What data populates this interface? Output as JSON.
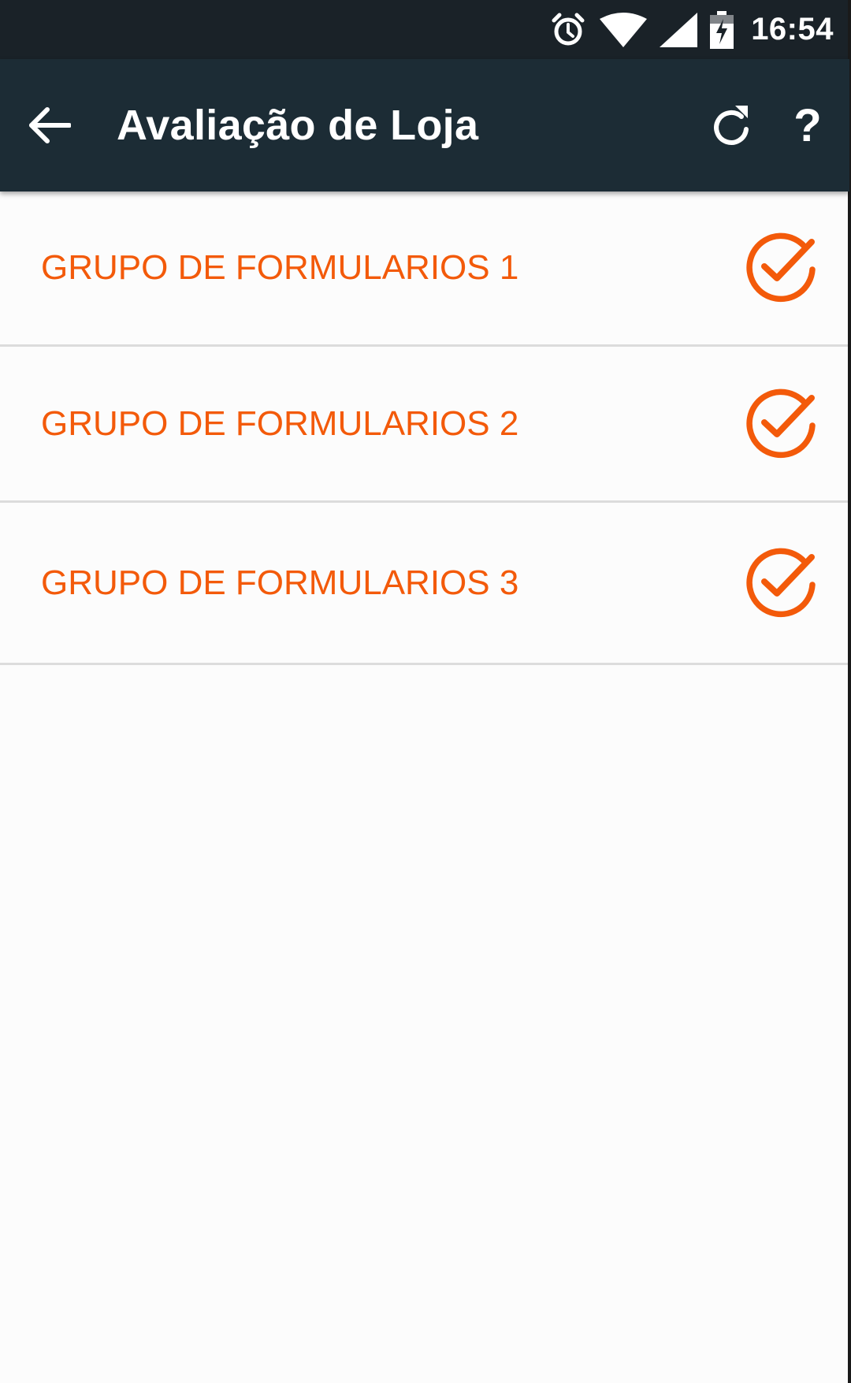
{
  "status_bar": {
    "time": "16:54",
    "icons": [
      "alarm-icon",
      "wifi-icon",
      "signal-icon",
      "battery-charging-icon"
    ]
  },
  "app_bar": {
    "title": "Avaliação de Loja",
    "back_icon": "arrow-back-icon",
    "refresh_icon": "refresh-icon",
    "help_label": "?"
  },
  "list": {
    "items": [
      {
        "label": "GRUPO DE FORMULARIOS 1",
        "status_icon": "check-circle-icon"
      },
      {
        "label": "GRUPO DE FORMULARIOS 2",
        "status_icon": "check-circle-icon"
      },
      {
        "label": "GRUPO DE FORMULARIOS 3",
        "status_icon": "check-circle-icon"
      }
    ]
  },
  "colors": {
    "status_bar_bg": "#1a2228",
    "app_bar_bg": "#1c2c35",
    "accent": "#f35a0a",
    "list_bg": "#fcfcfc",
    "divider": "#dcdcdc"
  }
}
